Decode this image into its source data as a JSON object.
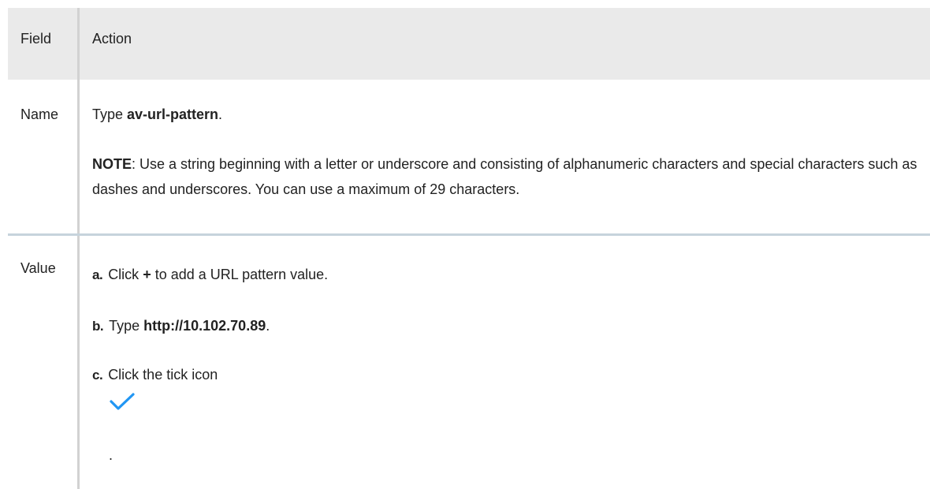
{
  "table": {
    "headers": {
      "field": "Field",
      "action": "Action"
    },
    "rows": {
      "name": {
        "field": "Name",
        "type_prefix": "Type ",
        "type_value": "av-url-pattern",
        "type_suffix": ".",
        "note_label": "NOTE",
        "note_text": ": Use a string beginning with a letter or underscore and consisting of alphanumeric characters and special characters such as dashes and underscores. You can use a maximum of 29 characters."
      },
      "value": {
        "field": "Value",
        "steps": [
          {
            "marker": "a.",
            "prefix": "Click ",
            "bold": "+",
            "suffix": " to add a URL pattern value."
          },
          {
            "marker": "b.",
            "prefix": "Type ",
            "bold": "http://10.102.70.89",
            "suffix": "."
          },
          {
            "marker": "c.",
            "prefix": "Click the tick icon",
            "bold": "",
            "suffix": ""
          }
        ],
        "tick_icon": "check-icon",
        "tick_color": "#2196f3",
        "trailing": "."
      }
    }
  },
  "colors": {
    "header_background": "#eaeaea",
    "text": "#222222",
    "column_divider": "#d2d2d2",
    "row_divider": "#c6d3dc"
  }
}
